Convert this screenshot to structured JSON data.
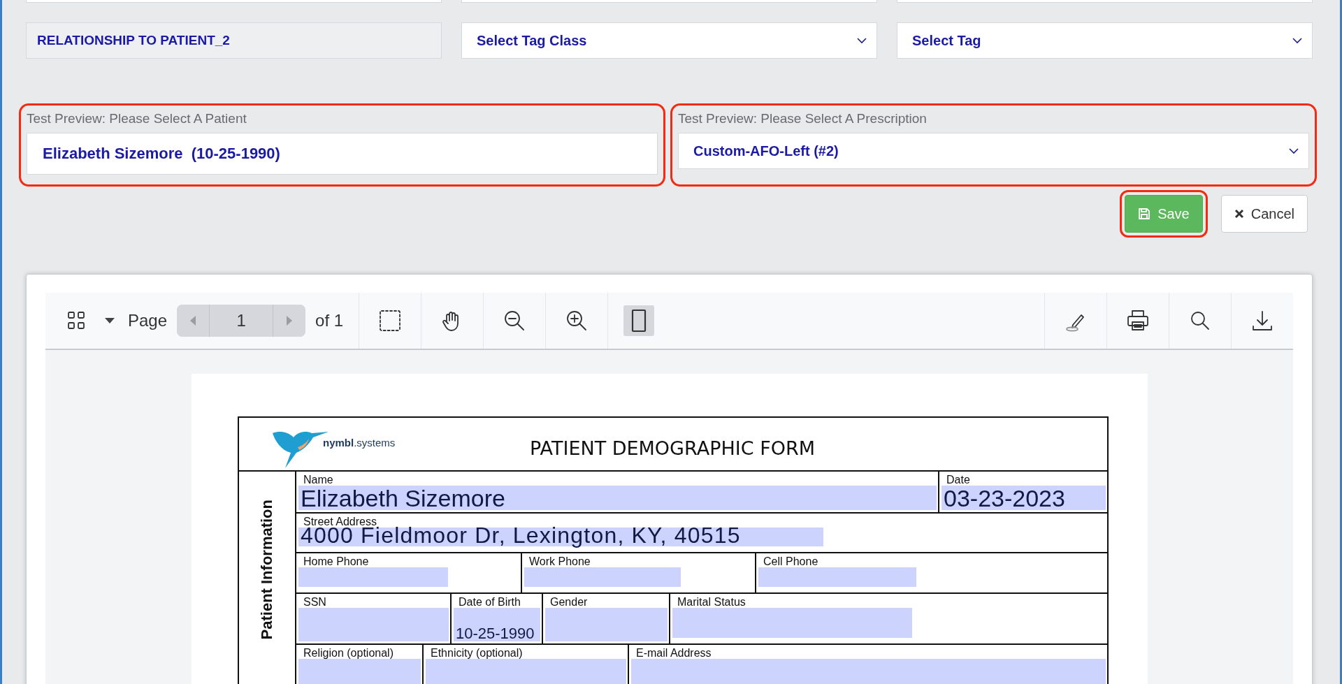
{
  "tag_rows": [
    {
      "label": "RELATIONSHIP TO PATIENT_2",
      "tag_class": "Select Tag Class",
      "tag": "Select Tag"
    }
  ],
  "test_preview": {
    "patient": {
      "label": "Test Preview: Please Select A Patient",
      "name": "Elizabeth Sizemore",
      "dob": "(10-25-1990)",
      "highlighted": true
    },
    "prescription": {
      "label": "Test Preview: Please Select A Prescription",
      "value": "Custom-AFO-Left (#2)",
      "highlighted": true
    }
  },
  "buttons": [
    {
      "label": "Save",
      "kind": "primary",
      "highlighted": true
    },
    {
      "label": "Cancel",
      "kind": "secondary",
      "highlighted": false
    }
  ],
  "viewer": {
    "toolbar": {
      "page_label": "Page",
      "page": "1",
      "page_count": "of 1"
    },
    "document": {
      "logo": "**nymbl**.systems",
      "title": "PATIENT DEMOGRAPHIC FORM",
      "section": "Patient Information",
      "rows": [
        [
          {
            "label": "Name",
            "value": "Elizabeth Sizemore"
          },
          {
            "label": "Date",
            "value": "03-23-2023"
          }
        ],
        [
          {
            "label": "Street Address",
            "value": "4000 Fieldmoor Dr, Lexington, KY, 40515"
          }
        ],
        [
          {
            "label": "Home Phone"
          },
          {
            "label": "Work Phone"
          },
          {
            "label": "Cell Phone"
          }
        ],
        [
          {
            "label": "SSN"
          },
          {
            "label": "Date of Birth",
            "value": "10-25-1990"
          },
          {
            "label": "Gender"
          },
          {
            "label": "Marital Status"
          }
        ],
        [
          {
            "label": "Religion (optional)"
          },
          {
            "label": "Ethnicity (optional)"
          },
          {
            "label": "E-mail Address"
          }
        ]
      ]
    }
  }
}
